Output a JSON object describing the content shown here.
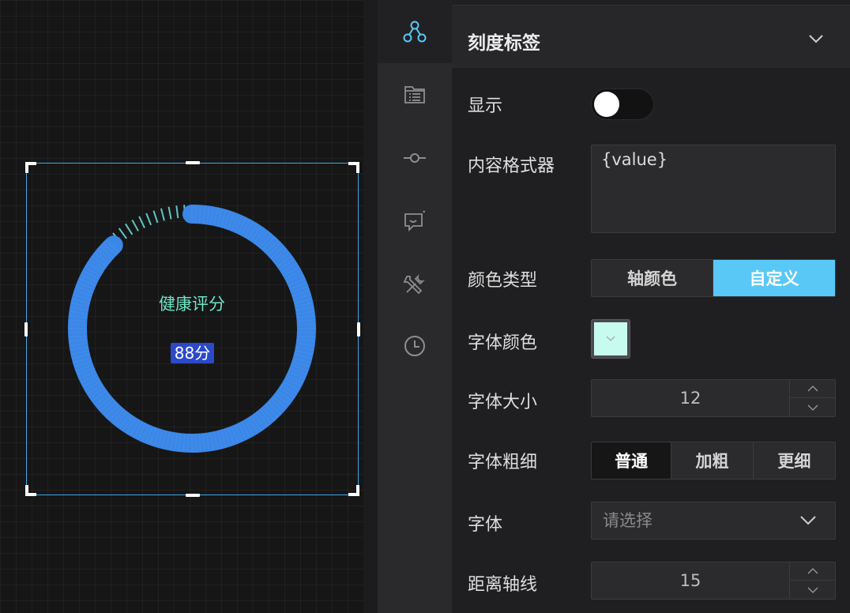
{
  "gauge": {
    "title": "健康评分",
    "value_label": "88分",
    "value": 88,
    "max": 100,
    "colors": {
      "bar": "#3a87e8",
      "ticks": "#5cc7c3",
      "title": "#6fe5c6",
      "value_bg": "#2b49c8"
    }
  },
  "rail": {
    "items": [
      {
        "icon": "graph-nodes-icon",
        "active": true
      },
      {
        "icon": "folder-list-icon",
        "active": false
      },
      {
        "icon": "commit-node-icon",
        "active": false
      },
      {
        "icon": "comment-smile-icon",
        "active": false
      },
      {
        "icon": "tools-icon",
        "active": false
      },
      {
        "icon": "clock-icon",
        "active": false
      }
    ],
    "active_color": "#5ac8f6"
  },
  "panel": {
    "title": "刻度标签",
    "show": {
      "label": "显示",
      "value": false
    },
    "formatter": {
      "label": "内容格式器",
      "value": "{value}"
    },
    "color_type": {
      "label": "颜色类型",
      "options": [
        "轴颜色",
        "自定义"
      ],
      "selected": "自定义"
    },
    "font_color": {
      "label": "字体颜色",
      "value": "#c8fbf0"
    },
    "font_size": {
      "label": "字体大小",
      "value": "12"
    },
    "font_weight": {
      "label": "字体粗细",
      "options": [
        "普通",
        "加粗",
        "更细"
      ],
      "selected": "普通"
    },
    "font_family": {
      "label": "字体",
      "placeholder": "请选择"
    },
    "axis_distance": {
      "label": "距离轴线",
      "value": "15"
    }
  }
}
